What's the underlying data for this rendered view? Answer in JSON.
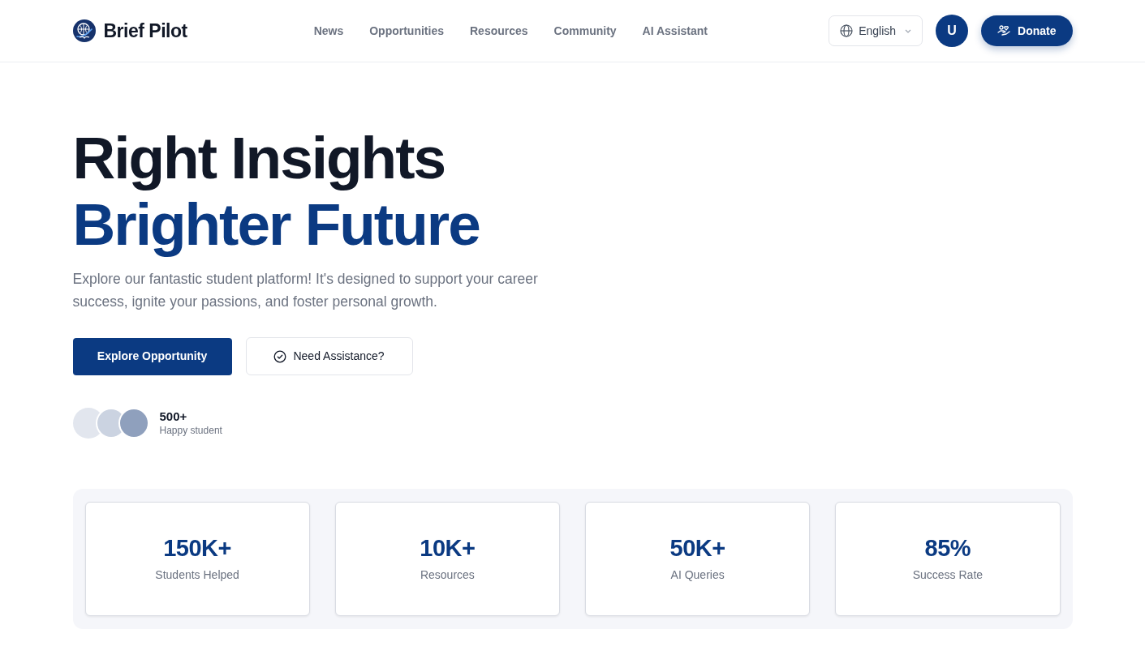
{
  "brand": {
    "name": "Brief Pilot"
  },
  "nav": [
    "News",
    "Opportunities",
    "Resources",
    "Community",
    "AI Assistant"
  ],
  "language": {
    "label": "English"
  },
  "user": {
    "initial": "U"
  },
  "donate": {
    "label": "Donate"
  },
  "hero": {
    "title_line_1": "Right Insights",
    "title_line_2": "Brighter Future",
    "description": "Explore our fantastic student platform! It's designed to support your career success, ignite your passions, and foster personal growth.",
    "buttons": [
      {
        "label": "Explore Opportunity",
        "kind": "primary"
      },
      {
        "label": "Need Assistance?",
        "kind": "outline"
      }
    ],
    "social_proof": {
      "count": "500+",
      "caption": "Happy student"
    }
  },
  "stats": [
    {
      "value": "150K+",
      "label": "Students Helped"
    },
    {
      "value": "10K+",
      "label": "Resources"
    },
    {
      "value": "50K+",
      "label": "AI Queries"
    },
    {
      "value": "85%",
      "label": "Success Rate"
    }
  ]
}
